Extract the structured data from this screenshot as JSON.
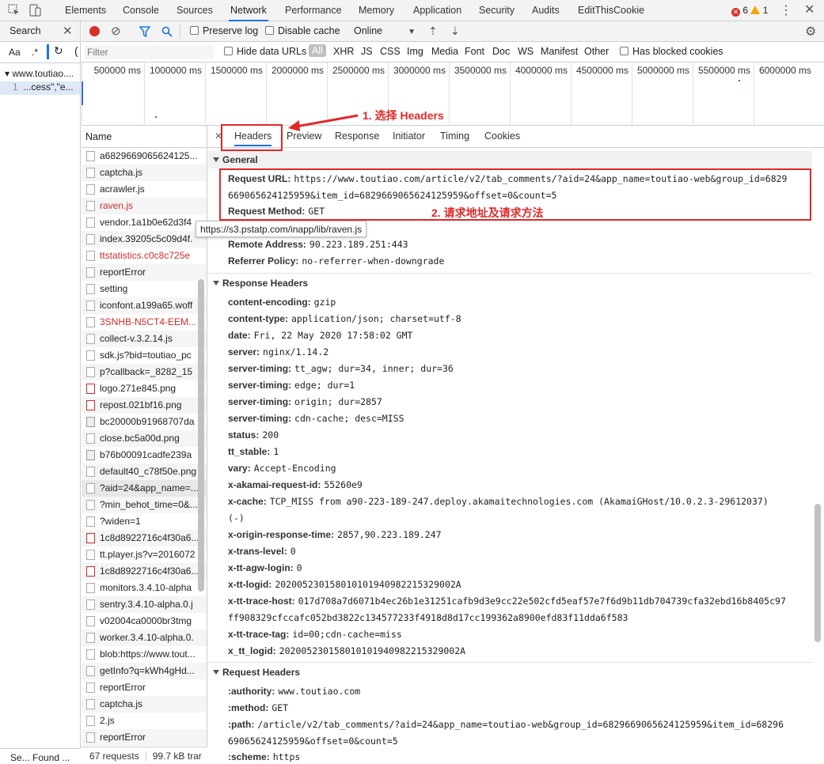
{
  "topbar": {
    "tabs": [
      "Elements",
      "Console",
      "Sources",
      "Network",
      "Performance",
      "Memory",
      "Application",
      "Security",
      "Audits",
      "EditThisCookie"
    ],
    "active_tab": "Network",
    "errors": "6",
    "warnings": "1"
  },
  "left_panel": {
    "title": "Search",
    "match_case": "Aa",
    "regex": ".*",
    "tree_root": "www.toutiao....",
    "tree_line_no": "1",
    "tree_match": "...cess\",\"e...",
    "footer": "Se...  Found ..."
  },
  "toolbar": {
    "preserve_log": "Preserve log",
    "disable_cache": "Disable cache",
    "throttle": "Online"
  },
  "filterbar": {
    "placeholder": "Filter",
    "hide_data_urls": "Hide data URLs",
    "types": [
      "All",
      "XHR",
      "JS",
      "CSS",
      "Img",
      "Media",
      "Font",
      "Doc",
      "WS",
      "Manifest",
      "Other"
    ],
    "blocked_cookies": "Has blocked cookies"
  },
  "timeline": {
    "ticks": [
      "500000 ms",
      "1000000 ms",
      "1500000 ms",
      "2000000 ms",
      "2500000 ms",
      "3000000 ms",
      "3500000 ms",
      "4000000 ms",
      "4500000 ms",
      "5000000 ms",
      "5500000 ms",
      "6000000 ms"
    ]
  },
  "requests": {
    "header": "Name",
    "rows": [
      "a6829669065624125...",
      "captcha.js",
      "acrawler.js",
      "raven.js",
      "vendor.1a1b0e62d3f4",
      "index.39205c5c09d4f.",
      "ttstatistics.c0c8c725e",
      "reportError",
      "setting",
      "iconfont.a199a65.woff",
      "3SNHB-N5CT4-EEM...",
      "collect-v.3.2.14.js",
      "sdk.js?bid=toutiao_pc",
      "p?callback=_8282_15",
      "logo.271e845.png",
      "repost.021bf16.png",
      "bc20000b91968707da",
      "close.bc5a00d.png",
      "b76b00091cadfe239a",
      "default40_c78f50e.png",
      "?aid=24&app_name=...",
      "?min_behot_time=0&...",
      "?widen=1",
      "1c8d8922716c4f30a6...",
      "tt.player.js?v=2016072",
      "1c8d8922716c4f30a6...",
      "monitors.3.4.10-alpha",
      "sentry.3.4.10-alpha.0.j",
      "v02004ca0000br3tmg",
      "worker.3.4.10-alpha.0.",
      "blob:https://www.tout...",
      "getInfo?q=kWh4gHd...",
      "reportError",
      "captcha.js",
      "2.js",
      "reportError"
    ],
    "footer_requests": "67 requests",
    "footer_size": "99.7 kB trar"
  },
  "tooltip": "https://s3.pstatp.com/inapp/lib/raven.js",
  "detail": {
    "tabs": [
      "Headers",
      "Preview",
      "Response",
      "Initiator",
      "Timing",
      "Cookies"
    ],
    "general_title": "General",
    "request_url_key": "Request URL:",
    "request_url_1": "https://www.toutiao.com/article/v2/tab_comments/?aid=24&app_name=toutiao-web&group_id=6829",
    "request_url_2": "669065624125959&item_id=6829669065624125959&offset=0&count=5",
    "request_method_key": "Request Method:",
    "request_method": "GET",
    "remote_key": "Remote Address:",
    "remote": "90.223.189.251:443",
    "referrer_key": "Referrer Policy:",
    "referrer": "no-referrer-when-downgrade",
    "response_title": "Response Headers",
    "response_headers": [
      [
        "content-encoding:",
        "gzip"
      ],
      [
        "content-type:",
        "application/json; charset=utf-8"
      ],
      [
        "date:",
        "Fri, 22 May 2020 17:58:02 GMT"
      ],
      [
        "server:",
        "nginx/1.14.2"
      ],
      [
        "server-timing:",
        "tt_agw; dur=34, inner; dur=36"
      ],
      [
        "server-timing:",
        "edge; dur=1"
      ],
      [
        "server-timing:",
        "origin; dur=2857"
      ],
      [
        "server-timing:",
        "cdn-cache; desc=MISS"
      ],
      [
        "status:",
        "200"
      ],
      [
        "tt_stable:",
        "1"
      ],
      [
        "vary:",
        "Accept-Encoding"
      ],
      [
        "x-akamai-request-id:",
        "55260e9"
      ],
      [
        "x-cache:",
        "TCP_MISS from a90-223-189-247.deploy.akamaitechnologies.com (AkamaiGHost/10.0.2.3-29612037)"
      ]
    ],
    "xcache_cont": "(-)",
    "response_headers2": [
      [
        "x-origin-response-time:",
        "2857,90.223.189.247"
      ],
      [
        "x-trans-level:",
        "0"
      ],
      [
        "x-tt-agw-login:",
        "0"
      ],
      [
        "x-tt-logid:",
        "20200523015801010194098221532900 2A"
      ]
    ],
    "trace_host_key": "x-tt-trace-host:",
    "trace_host_1": "017d708a7d6071b4ec26b1e31251cafb9d3e9cc22e502cfd5eaf57e7f6d9b11db704739cfa32ebd16b8405c97",
    "trace_host_2": "ff908329cfccafc052bd3822c134577233f4918d8d17cc199362a8900efd83f11dda6f583",
    "response_headers3": [
      [
        "x-tt-trace-tag:",
        "id=00;cdn-cache=miss"
      ],
      [
        "x_tt_logid:",
        "2020052301580101019409822153 29002A"
      ]
    ],
    "request_title": "Request Headers",
    "authority_key": ":authority:",
    "authority": "www.toutiao.com",
    "method_key": ":method:",
    "method": "GET",
    "path_key": ":path:",
    "path_1": "/article/v2/tab_comments/?aid=24&app_name=toutiao-web&group_id=6829669065624125959&item_id=68296",
    "path_2": "69065624125959&offset=0&count=5",
    "scheme_key": ":scheme:",
    "scheme": "https"
  },
  "annotations": {
    "a1": "1. 选择 Headers",
    "a2": "2. 请求地址及请求方法",
    "color": "#e02828"
  }
}
